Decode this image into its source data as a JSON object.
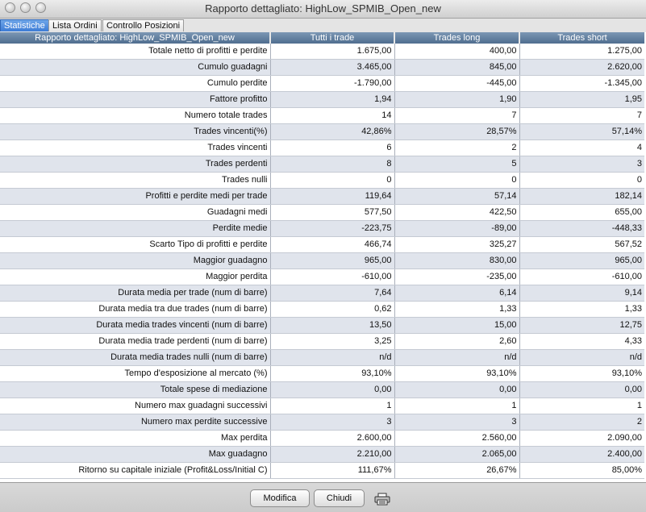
{
  "window": {
    "title": "Rapporto dettagliato: HighLow_SPMIB_Open_new"
  },
  "tabs": [
    "Statistiche",
    "Lista Ordini",
    "Controllo Posizioni"
  ],
  "table": {
    "headers": [
      "Rapporto dettagliato: HighLow_SPMIB_Open_new",
      "Tutti i trade",
      "Trades long",
      "Trades short"
    ],
    "rows": [
      [
        "Totale netto di profitti e perdite",
        "1.675,00",
        "400,00",
        "1.275,00"
      ],
      [
        "Cumulo guadagni",
        "3.465,00",
        "845,00",
        "2.620,00"
      ],
      [
        "Cumulo perdite",
        "-1.790,00",
        "-445,00",
        "-1.345,00"
      ],
      [
        "Fattore profitto",
        "1,94",
        "1,90",
        "1,95"
      ],
      [
        "Numero totale trades",
        "14",
        "7",
        "7"
      ],
      [
        "Trades vincenti(%)",
        "42,86%",
        "28,57%",
        "57,14%"
      ],
      [
        "Trades vincenti",
        "6",
        "2",
        "4"
      ],
      [
        "Trades perdenti",
        "8",
        "5",
        "3"
      ],
      [
        "Trades nulli",
        "0",
        "0",
        "0"
      ],
      [
        "Profitti e perdite medi per trade",
        "119,64",
        "57,14",
        "182,14"
      ],
      [
        "Guadagni medi",
        "577,50",
        "422,50",
        "655,00"
      ],
      [
        "Perdite medie",
        "-223,75",
        "-89,00",
        "-448,33"
      ],
      [
        "Scarto Tipo di profitti e perdite",
        "466,74",
        "325,27",
        "567,52"
      ],
      [
        "Maggior guadagno",
        "965,00",
        "830,00",
        "965,00"
      ],
      [
        "Maggior perdita",
        "-610,00",
        "-235,00",
        "-610,00"
      ],
      [
        "Durata media per trade (num di barre)",
        "7,64",
        "6,14",
        "9,14"
      ],
      [
        "Durata media tra due trades (num di barre)",
        "0,62",
        "1,33",
        "1,33"
      ],
      [
        "Durata media trades vincenti (num di barre)",
        "13,50",
        "15,00",
        "12,75"
      ],
      [
        "Durata media trade perdenti (num di barre)",
        "3,25",
        "2,60",
        "4,33"
      ],
      [
        "Durata media trades nulli (num di barre)",
        "n/d",
        "n/d",
        "n/d"
      ],
      [
        "Tempo d'esposizione al mercato (%)",
        "93,10%",
        "93,10%",
        "93,10%"
      ],
      [
        "Totale spese di mediazione",
        "0,00",
        "0,00",
        "0,00"
      ],
      [
        "Numero max guadagni successivi",
        "1",
        "1",
        "1"
      ],
      [
        "Numero max perdite successive",
        "3",
        "3",
        "2"
      ],
      [
        "Max perdita",
        "2.600,00",
        "2.560,00",
        "2.090,00"
      ],
      [
        "Max guadagno",
        "2.210,00",
        "2.065,00",
        "2.400,00"
      ],
      [
        "Ritorno su capitale iniziale (Profit&Loss/Initial C)",
        "111,67%",
        "26,67%",
        "85,00%"
      ]
    ]
  },
  "footer": {
    "modify_label": "Modifica",
    "close_label": "Chiudi",
    "print_icon": "printer-icon"
  }
}
